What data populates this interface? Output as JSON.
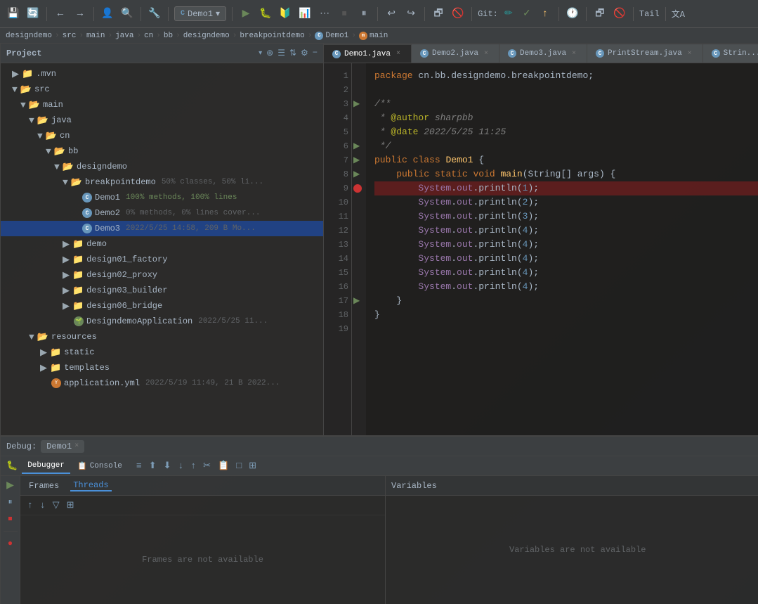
{
  "toolbar": {
    "save_icon": "💾",
    "refresh_icon": "🔄",
    "back_icon": "←",
    "forward_icon": "→",
    "vcs_icon": "👤",
    "search_icon": "🔍",
    "project_name": "Demo1",
    "run_icon": "▶",
    "debug_icon": "🐛",
    "coverage_icon": "🔰",
    "profile_icon": "📊",
    "stop_icon": "⏹",
    "pause_icon": "⏸",
    "build_icon": "🔨",
    "git_label": "Git:",
    "commit_icon": "✓",
    "push_icon": "↑",
    "tail_label": "Tail",
    "translate_icon": "文A"
  },
  "breadcrumb": {
    "parts": [
      "designdemo",
      "src",
      "main",
      "java",
      "cn",
      "bb",
      "designdemo",
      "breakpointdemo",
      "Demo1",
      "main"
    ]
  },
  "project": {
    "title": "Project",
    "items": [
      {
        "label": ".mvn",
        "type": "folder",
        "indent": 1,
        "expanded": false
      },
      {
        "label": "src",
        "type": "folder",
        "indent": 1,
        "expanded": true
      },
      {
        "label": "main",
        "type": "folder",
        "indent": 2,
        "expanded": true
      },
      {
        "label": "java",
        "type": "folder",
        "indent": 3,
        "expanded": true
      },
      {
        "label": "cn",
        "type": "folder",
        "indent": 4,
        "expanded": true
      },
      {
        "label": "bb",
        "type": "folder",
        "indent": 5,
        "expanded": true
      },
      {
        "label": "designdemo",
        "type": "folder",
        "indent": 6,
        "expanded": true
      },
      {
        "label": "breakpointdemo",
        "type": "folder",
        "indent": 7,
        "expanded": true,
        "meta": "50% classes, 50% li..."
      },
      {
        "label": "Demo1",
        "type": "java",
        "indent": 8,
        "meta": "100% methods, 100% lines"
      },
      {
        "label": "Demo2",
        "type": "java",
        "indent": 8,
        "meta": "0% methods, 0% lines cover..."
      },
      {
        "label": "Demo3",
        "type": "java",
        "indent": 8,
        "meta": "2022/5/25 14:58, 209 B Mo...",
        "selected": true
      },
      {
        "label": "demo",
        "type": "folder",
        "indent": 7,
        "expanded": false
      },
      {
        "label": "design01_factory",
        "type": "folder",
        "indent": 7,
        "expanded": false
      },
      {
        "label": "design02_proxy",
        "type": "folder",
        "indent": 7,
        "expanded": false
      },
      {
        "label": "design03_builder",
        "type": "folder",
        "indent": 7,
        "expanded": false
      },
      {
        "label": "design06_bridge",
        "type": "folder",
        "indent": 7,
        "expanded": false
      },
      {
        "label": "DesigndemoApplication",
        "type": "spring",
        "indent": 7,
        "meta": "2022/5/25 11..."
      },
      {
        "label": "resources",
        "type": "folder",
        "indent": 3,
        "expanded": true
      },
      {
        "label": "static",
        "type": "folder",
        "indent": 4,
        "expanded": false
      },
      {
        "label": "templates",
        "type": "folder",
        "indent": 4,
        "expanded": false
      },
      {
        "label": "application.yml",
        "type": "yaml",
        "indent": 4,
        "meta": "2022/5/19 11:49, 21 B 2022..."
      }
    ]
  },
  "editor": {
    "tabs": [
      {
        "label": "Demo1.java",
        "active": true,
        "type": "java"
      },
      {
        "label": "Demo2.java",
        "active": false,
        "type": "java"
      },
      {
        "label": "Demo3.java",
        "active": false,
        "type": "java"
      },
      {
        "label": "PrintStream.java",
        "active": false,
        "type": "java"
      },
      {
        "label": "Strin...",
        "active": false,
        "type": "java"
      }
    ],
    "lines": [
      {
        "num": 1,
        "text": "package cn.bb.designdemo.breakpointdemo;",
        "tokens": [
          {
            "t": "kw",
            "v": "package"
          },
          {
            "t": "",
            "v": " cn.bb.designdemo.breakpointdemo;"
          }
        ]
      },
      {
        "num": 2,
        "text": "",
        "tokens": []
      },
      {
        "num": 3,
        "text": "/**",
        "tokens": [
          {
            "t": "comment",
            "v": "/**"
          }
        ],
        "has_arrow": true
      },
      {
        "num": 4,
        "text": " * @author sharpbb",
        "tokens": [
          {
            "t": "comment",
            "v": " * "
          },
          {
            "t": "annotation",
            "v": "@author"
          },
          {
            "t": "comment",
            "v": " sharpbb"
          }
        ]
      },
      {
        "num": 5,
        "text": " * @date 2022/5/25 11:25",
        "tokens": [
          {
            "t": "comment",
            "v": " * "
          },
          {
            "t": "annotation",
            "v": "@date"
          },
          {
            "t": "comment",
            "v": " 2022/5/25 11:25"
          }
        ]
      },
      {
        "num": 6,
        "text": " */",
        "tokens": [
          {
            "t": "comment",
            "v": " */"
          }
        ],
        "has_arrow": true
      },
      {
        "num": 7,
        "text": "public class Demo1 {",
        "tokens": [
          {
            "t": "kw",
            "v": "public"
          },
          {
            "t": "",
            "v": " "
          },
          {
            "t": "kw",
            "v": "class"
          },
          {
            "t": "",
            "v": " "
          },
          {
            "t": "class-name",
            "v": "Demo1"
          },
          {
            "t": "",
            "v": " {"
          }
        ],
        "has_arrow": true
      },
      {
        "num": 8,
        "text": "    public static void main(String[] args) {",
        "tokens": [
          {
            "t": "",
            "v": "    "
          },
          {
            "t": "kw",
            "v": "public"
          },
          {
            "t": "",
            "v": " "
          },
          {
            "t": "kw",
            "v": "static"
          },
          {
            "t": "",
            "v": " "
          },
          {
            "t": "kw",
            "v": "void"
          },
          {
            "t": "",
            "v": " "
          },
          {
            "t": "method",
            "v": "main"
          },
          {
            "t": "",
            "v": "("
          },
          {
            "t": "type",
            "v": "String"
          },
          {
            "t": "",
            "v": "[] args) {"
          }
        ],
        "has_arrow": true
      },
      {
        "num": 9,
        "text": "        System.out.println(1);",
        "tokens": [
          {
            "t": "",
            "v": "        "
          },
          {
            "t": "sys",
            "v": "System"
          },
          {
            "t": "",
            "v": "."
          },
          {
            "t": "sys",
            "v": "out"
          },
          {
            "t": "",
            "v": ".println("
          },
          {
            "t": "num",
            "v": "1"
          },
          {
            "t": "",
            "v": ");"
          }
        ],
        "breakpoint": true,
        "highlighted": true
      },
      {
        "num": 10,
        "text": "        System.out.println(2);",
        "tokens": [
          {
            "t": "",
            "v": "        "
          },
          {
            "t": "sys",
            "v": "System"
          },
          {
            "t": "",
            "v": "."
          },
          {
            "t": "sys",
            "v": "out"
          },
          {
            "t": "",
            "v": ".println("
          },
          {
            "t": "num",
            "v": "2"
          },
          {
            "t": "",
            "v": ");"
          }
        ]
      },
      {
        "num": 11,
        "text": "        System.out.println(3);",
        "tokens": [
          {
            "t": "",
            "v": "        "
          },
          {
            "t": "sys",
            "v": "System"
          },
          {
            "t": "",
            "v": "."
          },
          {
            "t": "sys",
            "v": "out"
          },
          {
            "t": "",
            "v": ".println("
          },
          {
            "t": "num",
            "v": "3"
          },
          {
            "t": "",
            "v": ");"
          }
        ]
      },
      {
        "num": 12,
        "text": "        System.out.println(4);",
        "tokens": [
          {
            "t": "",
            "v": "        "
          },
          {
            "t": "sys",
            "v": "System"
          },
          {
            "t": "",
            "v": "."
          },
          {
            "t": "sys",
            "v": "out"
          },
          {
            "t": "",
            "v": ".println("
          },
          {
            "t": "num",
            "v": "4"
          },
          {
            "t": "",
            "v": ");"
          }
        ]
      },
      {
        "num": 13,
        "text": "        System.out.println(4);",
        "tokens": [
          {
            "t": "",
            "v": "        "
          },
          {
            "t": "sys",
            "v": "System"
          },
          {
            "t": "",
            "v": "."
          },
          {
            "t": "sys",
            "v": "out"
          },
          {
            "t": "",
            "v": ".println("
          },
          {
            "t": "num",
            "v": "4"
          },
          {
            "t": "",
            "v": ");"
          }
        ]
      },
      {
        "num": 14,
        "text": "        System.out.println(4);",
        "tokens": [
          {
            "t": "",
            "v": "        "
          },
          {
            "t": "sys",
            "v": "System"
          },
          {
            "t": "",
            "v": "."
          },
          {
            "t": "sys",
            "v": "out"
          },
          {
            "t": "",
            "v": ".println("
          },
          {
            "t": "num",
            "v": "4"
          },
          {
            "t": "",
            "v": ");"
          }
        ]
      },
      {
        "num": 15,
        "text": "        System.out.println(4);",
        "tokens": [
          {
            "t": "",
            "v": "        "
          },
          {
            "t": "sys",
            "v": "System"
          },
          {
            "t": "",
            "v": "."
          },
          {
            "t": "sys",
            "v": "out"
          },
          {
            "t": "",
            "v": ".println("
          },
          {
            "t": "num",
            "v": "4"
          },
          {
            "t": "",
            "v": ");"
          }
        ]
      },
      {
        "num": 16,
        "text": "        System.out.println(4);",
        "tokens": [
          {
            "t": "",
            "v": "        "
          },
          {
            "t": "sys",
            "v": "System"
          },
          {
            "t": "",
            "v": "."
          },
          {
            "t": "sys",
            "v": "out"
          },
          {
            "t": "",
            "v": ".println("
          },
          {
            "t": "num",
            "v": "4"
          },
          {
            "t": "",
            "v": ");"
          }
        ]
      },
      {
        "num": 17,
        "text": "    }",
        "tokens": [
          {
            "t": "",
            "v": "    }"
          }
        ],
        "has_arrow": true
      },
      {
        "num": 18,
        "text": "}",
        "tokens": [
          {
            "t": "",
            "v": "}"
          }
        ]
      },
      {
        "num": 19,
        "text": "",
        "tokens": []
      }
    ]
  },
  "debug": {
    "session_label": "Debug:",
    "session_name": "Demo1",
    "tabs": [
      {
        "label": "Debugger",
        "active": true,
        "icon": "🐛"
      },
      {
        "label": "Console",
        "active": false,
        "icon": "📋"
      }
    ],
    "sections": {
      "frames_label": "Frames",
      "threads_label": "Threads",
      "frames_empty": "Frames are not available",
      "variables_label": "Variables",
      "variables_empty": "Variables are not available"
    }
  }
}
